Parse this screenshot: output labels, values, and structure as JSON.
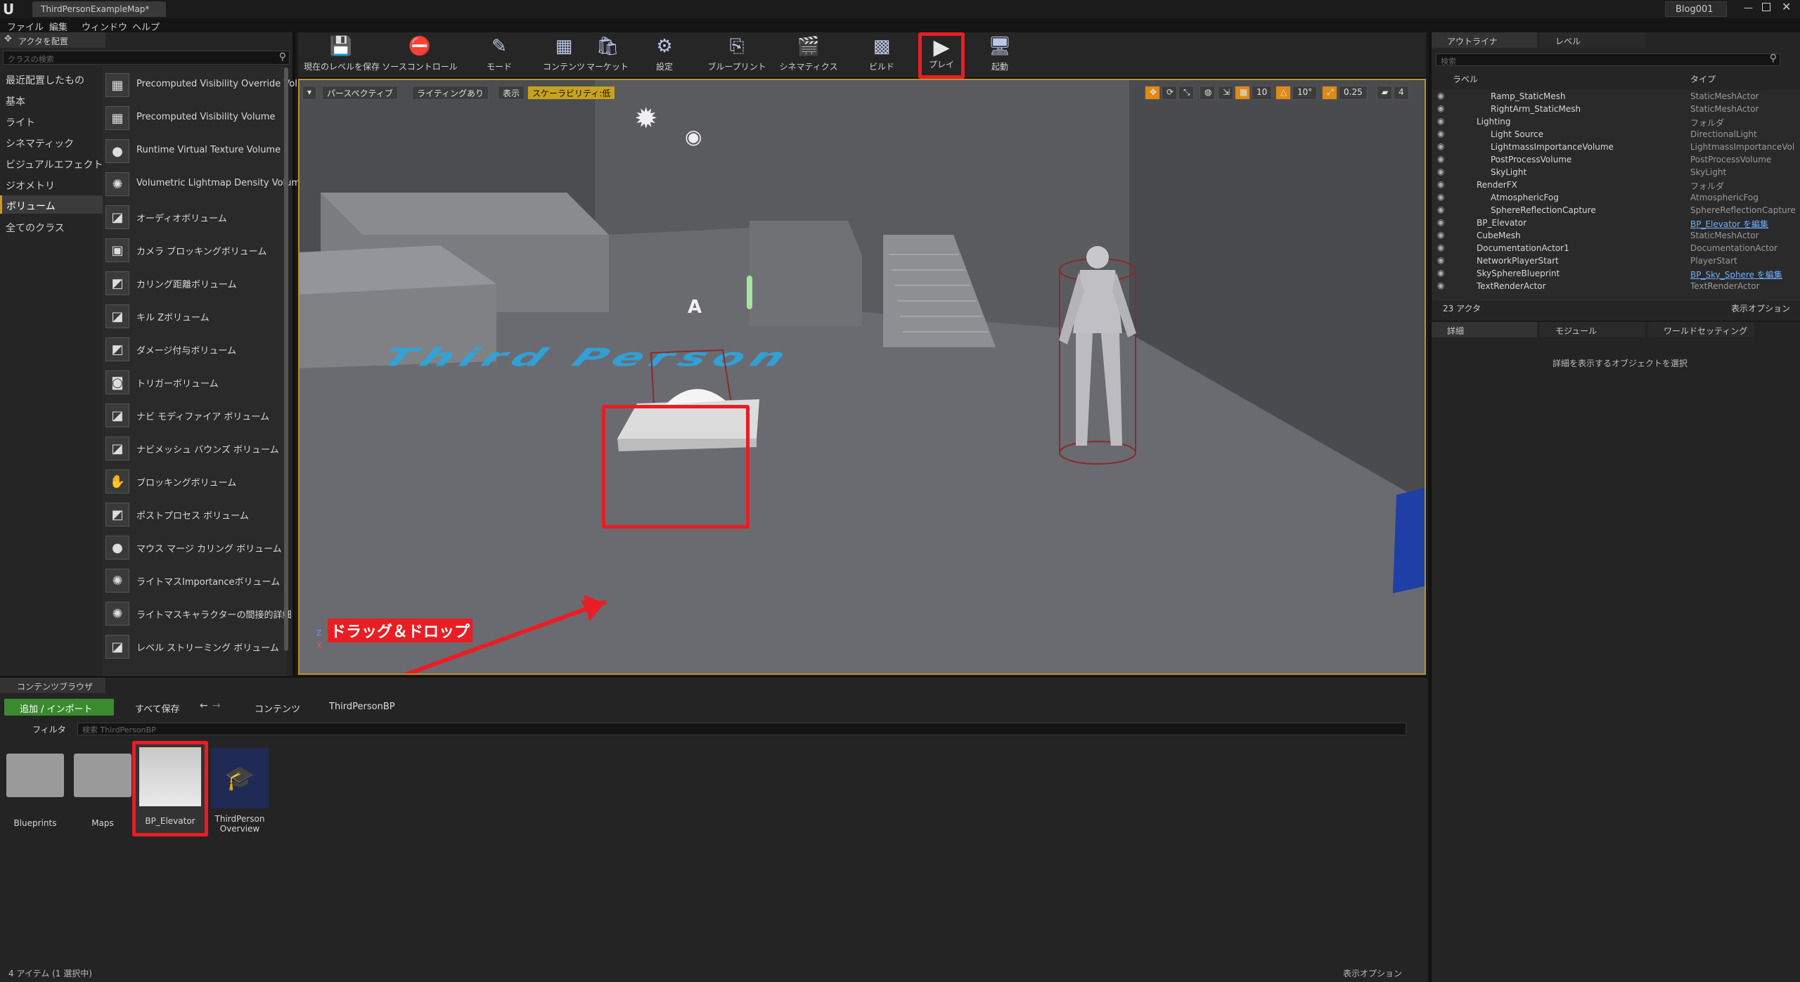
{
  "app": {
    "tab_title": "ThirdPersonExampleMap*",
    "project_name": "Blog001",
    "logo": "U"
  },
  "menu": [
    "ファイル",
    "編集",
    "ウィンドウ",
    "ヘルプ"
  ],
  "placement": {
    "tab_label": "アクタを配置",
    "search_placeholder": "クラスの検索",
    "categories": [
      "最近配置したもの",
      "基本",
      "ライト",
      "シネマティック",
      "ビジュアルエフェクト",
      "ジオメトリ",
      "ボリューム",
      "全てのクラス"
    ],
    "selected_category": "ボリューム",
    "items": [
      "Precomputed Visibility Override Vol",
      "Precomputed Visibility Volume",
      "Runtime Virtual Texture Volume",
      "Volumetric Lightmap Density Volum",
      "オーディオボリューム",
      "カメラ ブロッキングボリューム",
      "カリング距離ボリューム",
      "キル Zボリューム",
      "ダメージ付与ボリューム",
      "トリガーボリューム",
      "ナビ モディファイア ボリューム",
      "ナビメッシュ バウンズ ボリューム",
      "ブロッキングボリューム",
      "ポストプロセス ボリューム",
      "マウス マージ カリング ボリューム",
      "ライトマスImportanceボリューム",
      "ライトマスキャラクターの間接的詳細",
      "レベル ストリーミング ボリューム"
    ]
  },
  "toolbar": {
    "buttons": [
      {
        "label": "現在のレベルを保存",
        "icon": "save-icon"
      },
      {
        "label": "ソースコントロール",
        "icon": "source-control-icon"
      },
      {
        "label": "モード",
        "icon": "modes-icon"
      },
      {
        "label": "コンテンツ",
        "icon": "content-icon"
      },
      {
        "label": "マーケット",
        "icon": "marketplace-icon"
      },
      {
        "label": "設定",
        "icon": "settings-icon"
      },
      {
        "label": "ブループリント",
        "icon": "blueprint-icon"
      },
      {
        "label": "シネマティクス",
        "icon": "cinematics-icon"
      },
      {
        "label": "ビルド",
        "icon": "build-icon"
      },
      {
        "label": "プレイ",
        "icon": "play-icon"
      },
      {
        "label": "起動",
        "icon": "launch-icon"
      }
    ]
  },
  "viewport": {
    "perspective": "パースペクティブ",
    "lighting": "ライティングあり",
    "show": "表示",
    "scalability": "スケーラビリティ:低",
    "grid_snap": "10",
    "rot_snap": "10°",
    "scale_snap": "0.25",
    "cam_speed": "4",
    "floor_text": "Third Person",
    "annotation": "ドラッグ＆ドロップ",
    "axis_z": "Z",
    "axis_x": "X"
  },
  "outliner": {
    "tab_label": "アウトライナ",
    "level_tab": "レベル",
    "search_placeholder": "検索",
    "col_label": "ラベル",
    "col_type": "タイプ",
    "rows": [
      {
        "label": "Ramp_StaticMesh",
        "type": "StaticMeshActor",
        "indent": 2
      },
      {
        "label": "RightArm_StaticMesh",
        "type": "StaticMeshActor",
        "indent": 2
      },
      {
        "label": "Lighting",
        "type": "フォルダ",
        "indent": 1
      },
      {
        "label": "Light Source",
        "type": "DirectionalLight",
        "indent": 2
      },
      {
        "label": "LightmassImportanceVolume",
        "type": "LightmassImportanceVol",
        "indent": 2
      },
      {
        "label": "PostProcessVolume",
        "type": "PostProcessVolume",
        "indent": 2
      },
      {
        "label": "SkyLight",
        "type": "SkyLight",
        "indent": 2
      },
      {
        "label": "RenderFX",
        "type": "フォルダ",
        "indent": 1
      },
      {
        "label": "AtmosphericFog",
        "type": "AtmosphericFog",
        "indent": 2
      },
      {
        "label": "SphereReflectionCapture",
        "type": "SphereReflectionCapture",
        "indent": 2
      },
      {
        "label": "BP_Elevator",
        "type": "BP_Elevator を編集",
        "indent": 1,
        "link": true
      },
      {
        "label": "CubeMesh",
        "type": "StaticMeshActor",
        "indent": 1
      },
      {
        "label": "DocumentationActor1",
        "type": "DocumentationActor",
        "indent": 1
      },
      {
        "label": "NetworkPlayerStart",
        "type": "PlayerStart",
        "indent": 1
      },
      {
        "label": "SkySphereBlueprint",
        "type": "BP_Sky_Sphere を編集",
        "indent": 1,
        "link": true
      },
      {
        "label": "TextRenderActor",
        "type": "TextRenderActor",
        "indent": 1
      }
    ],
    "actor_count": "23 アクタ",
    "view_options": "表示オプション"
  },
  "details": {
    "tab_details": "詳細",
    "tab_modes": "モジュール",
    "tab_world": "ワールドセッティング",
    "empty_message": "詳細を表示するオブジェクトを選択"
  },
  "content_browser": {
    "tab_label": "コンテンツブラウザ",
    "add_import": "追加 / インポート",
    "save_all": "すべて保存",
    "path_root": "コンテンツ",
    "path_folder": "ThirdPersonBP",
    "filters": "フィルタ",
    "search_placeholder": "検索 ThirdPersonBP",
    "assets": [
      "Blueprints",
      "Maps",
      "BP_Elevator",
      "ThirdPerson Overview"
    ],
    "status": "4 アイテム (1 選択中)",
    "view_options": "表示オプション"
  },
  "colors": {
    "accent_highlight": "#e81e24",
    "selection_gold": "#b8922a",
    "add_button_green": "#3a8a2e",
    "floor_text_blue": "#2aa6e0",
    "link_blue": "#6fb0ff"
  }
}
